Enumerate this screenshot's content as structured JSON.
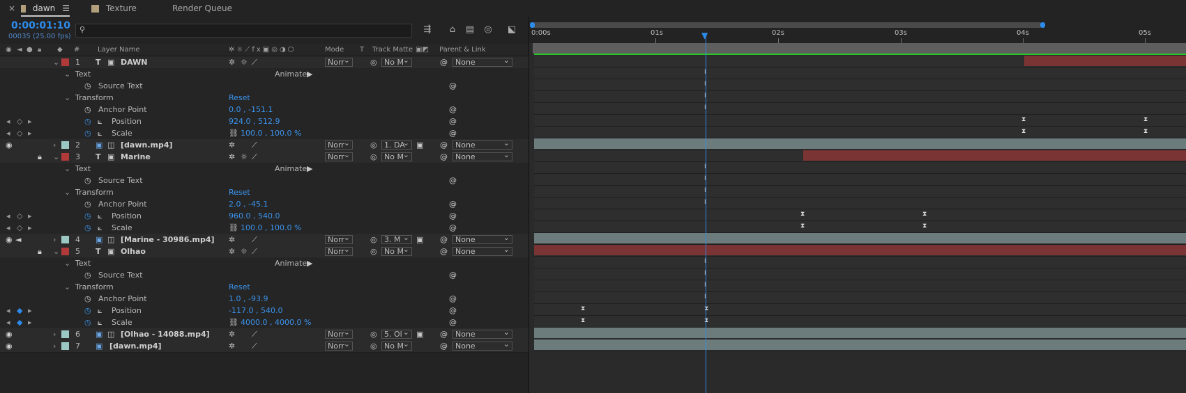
{
  "tabs": [
    {
      "label": "dawn",
      "active": true
    },
    {
      "label": "Texture",
      "active": false
    },
    {
      "label": "Render Queue",
      "active": false
    }
  ],
  "timecode": "0:00:01:10",
  "fps_text": "00035 (25.00 fps)",
  "search": {
    "placeholder": ""
  },
  "columns": {
    "hash": "#",
    "layer_name": "Layer Name",
    "mode": "Mode",
    "t": "T",
    "track_matte": "Track Matte",
    "parent_link": "Parent & Link"
  },
  "layers": [
    {
      "num": "1",
      "name": "DAWN",
      "mode": "Norr",
      "matte": "No M",
      "parent": "None",
      "props": {
        "text": "Text",
        "animate": "Animate:",
        "source_text": "Source Text",
        "transform": "Transform",
        "reset": "Reset",
        "anchor_label": "Anchor Point",
        "anchor": "0.0 , -151.1",
        "position_label": "Position",
        "position": "924.0 , 512.9",
        "scale_label": "Scale",
        "scale": "100.0 , 100.0 %"
      }
    },
    {
      "num": "2",
      "name": "[dawn.mp4]",
      "mode": "Norr",
      "matte": "1. DA",
      "parent": "None"
    },
    {
      "num": "3",
      "name": "Marine",
      "mode": "Norr",
      "matte": "No M",
      "parent": "None",
      "props": {
        "text": "Text",
        "animate": "Animate:",
        "source_text": "Source Text",
        "transform": "Transform",
        "reset": "Reset",
        "anchor_label": "Anchor Point",
        "anchor": "2.0 , -45.1",
        "position_label": "Position",
        "position": "960.0 , 540.0",
        "scale_label": "Scale",
        "scale": "100.0 , 100.0 %"
      }
    },
    {
      "num": "4",
      "name": "[Marine - 30986.mp4]",
      "mode": "Norr",
      "matte": "3. M",
      "parent": "None"
    },
    {
      "num": "5",
      "name": "Olhao",
      "mode": "Norr",
      "matte": "No M",
      "parent": "None",
      "props": {
        "text": "Text",
        "animate": "Animate:",
        "source_text": "Source Text",
        "transform": "Transform",
        "reset": "Reset",
        "anchor_label": "Anchor Point",
        "anchor": "1.0 , -93.9",
        "position_label": "Position",
        "position": "-117.0 , 540.0",
        "scale_label": "Scale",
        "scale": "4000.0 , 4000.0 %"
      }
    },
    {
      "num": "6",
      "name": "[Olhao - 14088.mp4]",
      "mode": "Norr",
      "matte": "5. Ol",
      "parent": "None"
    },
    {
      "num": "7",
      "name": "[dawn.mp4]",
      "mode": "Norr",
      "matte": "No M",
      "parent": "None"
    }
  ],
  "ruler": [
    "0:00s",
    "01s",
    "02s",
    "03s",
    "04s",
    "05s"
  ],
  "colors": {
    "accent": "#2d8ceb",
    "label_red": "#b03a3a",
    "label_teal": "#9cc8c4",
    "bar_red": "#7a3434",
    "bar_grey": "#6c7c7c",
    "work_green": "#28c828"
  }
}
